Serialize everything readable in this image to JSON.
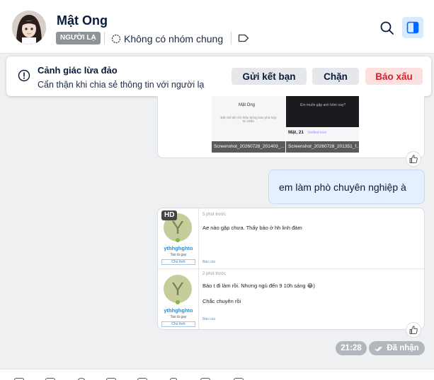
{
  "header": {
    "name": "Mật Ong",
    "stranger_label": "NGƯỜI LẠ",
    "groups_text": "Không có nhóm chung"
  },
  "warning": {
    "title": "Cảnh giác lừa đảo",
    "description": "Cẩn thận khi chia sẻ thông tin với người lạ",
    "add_friend": "Gửi kết bạn",
    "block": "Chặn",
    "report": "Báo xấu"
  },
  "messages": {
    "screenshots": {
      "top_date": "/",
      "left_caption": "Screenshot_20260728_201403_...",
      "right_caption": "Screenshot_20260728_201351_f...",
      "left_profile_name": "Mật Ong",
      "left_profile_text": "Bật chế độ chỉ nhận thông báo phù hợp tin nhắn",
      "right_profile_name": "Mật, 21",
      "right_link": "Verified love",
      "right_thumb_text": "Em muốn gặp anh hôm nay?"
    },
    "outgoing_text": "em làm phò chuyên nghiệp à",
    "forwarded": {
      "hd_label": "HD",
      "posts": [
        {
          "avatar_letter": "Y",
          "username": "ythhghghto",
          "subtitle": "Tao là gay",
          "role": "Chủ thớt",
          "time": "5 phút trước",
          "lines": [
            "Ae nào gặp chưa. Thấy bảo ở hh linh đàm"
          ],
          "report": "Báo cáo"
        },
        {
          "avatar_letter": "Y",
          "username": "ythhghghto",
          "subtitle": "Tao là gay",
          "role": "Chủ thớt",
          "time": "2 phút trước",
          "lines": [
            "Báo t đi làm rồi. Nhưng ngủ đến 9 10h sáng 😂)",
            "Chắc chuyên rồi"
          ],
          "report": "Báo cáo"
        }
      ]
    },
    "time": "21:28",
    "status": "Đã nhận"
  },
  "colors": {
    "accent": "#0068ff",
    "report_red": "#d4202c",
    "bubble_out": "#e5efff",
    "pill_gray": "#b3b7bd"
  }
}
